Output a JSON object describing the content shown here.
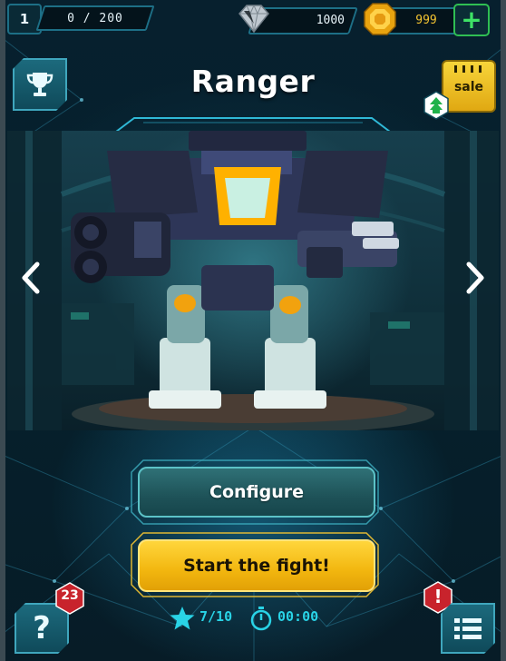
{
  "header": {
    "level": "1",
    "xp": "0 / 200",
    "gems": "1000",
    "coins": "999",
    "add_label": "+"
  },
  "robot": {
    "name": "Ranger"
  },
  "sale": {
    "label": "sale"
  },
  "actions": {
    "configure_label": "Configure",
    "fight_label": "Start the fight!"
  },
  "stats": {
    "stars": "7/10",
    "timer": "00:00"
  },
  "corners": {
    "help_label": "?",
    "help_badge": "23",
    "alert_label": "!"
  },
  "icons": {
    "trophy": "trophy-icon",
    "gem": "diamond-icon",
    "coin": "gold-coin-icon",
    "sale": "calendar-sale-icon",
    "upgrade": "upgrade-arrows-icon",
    "prev": "chevron-left-icon",
    "next": "chevron-right-icon",
    "star": "star-icon",
    "timer": "stopwatch-icon",
    "menu": "list-icon"
  },
  "colors": {
    "accent_teal": "#29d3e6",
    "gold": "#f5c531",
    "green": "#3ee266",
    "alert_red": "#c8232c"
  }
}
